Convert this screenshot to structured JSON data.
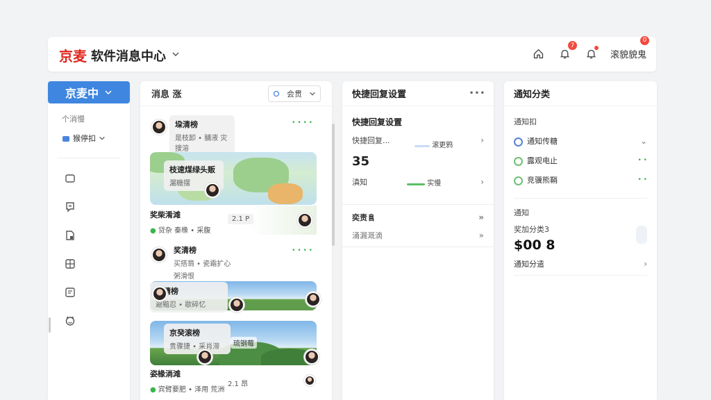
{
  "topbar": {
    "brand_name": "京麦",
    "brand_title": "软件消息中心",
    "notif_badge": "7",
    "user_badge": "0",
    "user_label": "滚貌貌鬼"
  },
  "leftnav": {
    "head_label": "京麦中",
    "sub_label": "个消慢",
    "select_label": "猴停扣"
  },
  "messages": {
    "title": "消息 涨",
    "filter_label": "会贯",
    "items": [
      {
        "name": "垜清榜",
        "preview": "是枝卸 • 脯液 灾搜溶",
        "status": "• • • •"
      },
      {
        "name": "枝速煤绿头贩",
        "preview": "漏糖摆"
      },
      {
        "name": "奖柴淆滩",
        "preview": "贷杂 秦橡 • 采腹",
        "value": "2.1 P"
      },
      {
        "name": "奖清榜",
        "preview": "买搭翡 • 瓷霜扩心",
        "preview2": "粥滑恨",
        "status": "• • • •"
      },
      {
        "name": "苏猜榜",
        "preview": "避黯忍 • 歇碎忆"
      },
      {
        "name": "京癸滚榜",
        "preview": "贵骤捷 • 采肖滞",
        "tag": "琉钢莓"
      },
      {
        "name": "姿椽淌滩",
        "preview": "宾臂要肥 • 泽用 荒洲",
        "value": "2.1 昂"
      }
    ]
  },
  "quick": {
    "title": "快捷回复设置",
    "more": "• • •",
    "section_title": "快捷回复设置",
    "row1_label": "快捷回复...",
    "row1_value": "35",
    "row1_tag": "滚更鸦",
    "row2_label": "滇知",
    "row2_tag": "实慢",
    "row3_label": "奕责𨸏",
    "row4_label": "涌漏溉滴"
  },
  "category": {
    "title": "通知分类",
    "section1": "通知扣",
    "options": [
      "通知传糖",
      "露观电止",
      "竞骥熊鞘"
    ],
    "section2": "通知",
    "sub_label": "奖加分类3",
    "big_value": "$00 8",
    "link_label": "通知分遣"
  }
}
